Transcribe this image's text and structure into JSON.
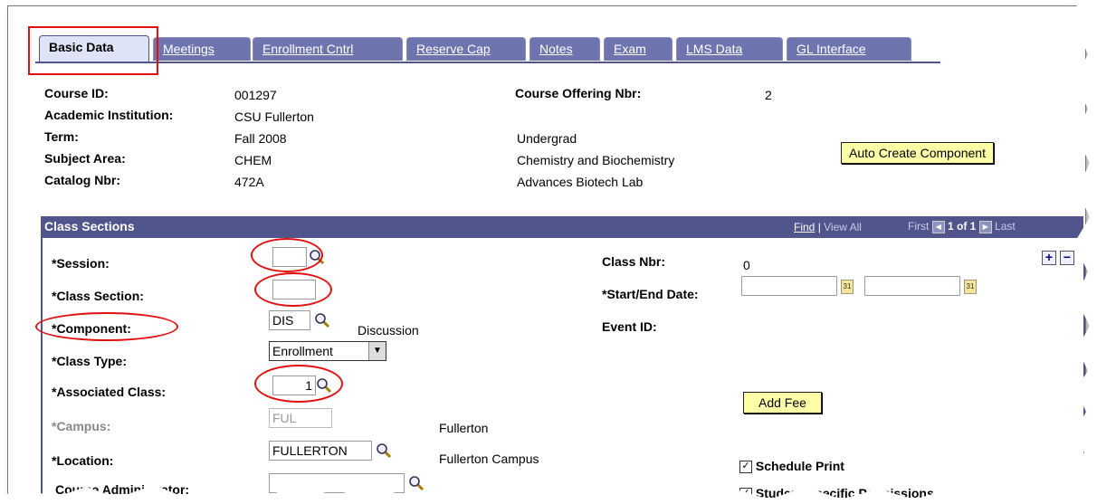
{
  "tabs": [
    {
      "label": "Basic Data",
      "active": true
    },
    {
      "label": "Meetings"
    },
    {
      "label": "Enrollment Cntrl"
    },
    {
      "label": "Reserve Cap"
    },
    {
      "label": "Notes"
    },
    {
      "label": "Exam"
    },
    {
      "label": "LMS Data"
    },
    {
      "label": "GL Interface"
    }
  ],
  "header": {
    "course_id_label": "Course ID:",
    "course_id": "001297",
    "institution_label": "Academic Institution:",
    "institution": "CSU Fullerton",
    "term_label": "Term:",
    "term": "Fall 2008",
    "career": "Undergrad",
    "subject_label": "Subject Area:",
    "subject": "CHEM",
    "subject_desc": "Chemistry and Biochemistry",
    "catalog_label": "Catalog Nbr:",
    "catalog": "472A",
    "catalog_desc": "Advances Biotech Lab",
    "offering_label": "Course Offering Nbr:",
    "offering": "2",
    "auto_create_button": "Auto Create Component"
  },
  "sections": {
    "title": "Class Sections",
    "find": "Find",
    "view_all": "View All",
    "first": "First",
    "count": "1 of 1",
    "last": "Last"
  },
  "form": {
    "session_label": "*Session:",
    "class_section_label": "*Class Section:",
    "component_label": "*Component:",
    "component_value": "DIS",
    "component_desc": "Discussion",
    "class_type_label": "*Class Type:",
    "class_type_value": "Enrollment",
    "assoc_label": "*Associated Class:",
    "assoc_value": "1",
    "campus_label": "*Campus:",
    "campus_value": "FUL",
    "campus_desc": "Fullerton",
    "location_label": "*Location:",
    "location_value": "FULLERTON",
    "location_desc": "Fullerton Campus",
    "course_admin_label": "Course Administrator:",
    "class_nbr_label": "Class Nbr:",
    "class_nbr_value": "0",
    "start_end_label": "*Start/End Date:",
    "event_id_label": "Event ID:",
    "add_fee_button": "Add Fee",
    "schedule_print_label": "Schedule Print",
    "student_permissions_label": "Student Specific Permissions"
  },
  "icons": {
    "plus": "+",
    "minus": "−",
    "calendar": "31"
  },
  "colors": {
    "accent": "#50558c",
    "highlight": "#e01010",
    "button_bg": "#ffffa8"
  }
}
